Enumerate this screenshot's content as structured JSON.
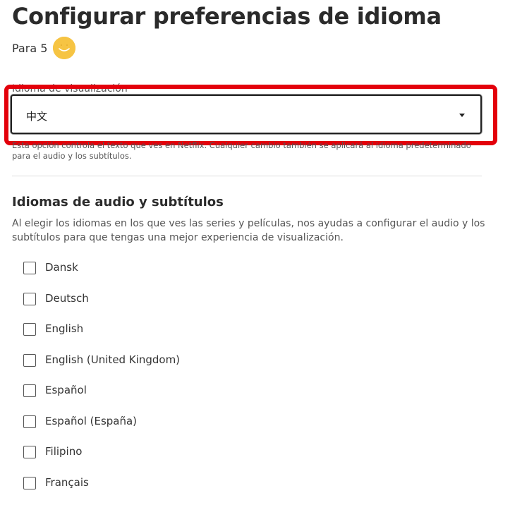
{
  "header": {
    "title": "Configurar preferencias de idioma",
    "profile_label": "Para 5",
    "avatar_icon": "smiley-face-icon",
    "avatar_color": "#f6c443"
  },
  "display_language": {
    "label": "Idioma de visualización",
    "selected": "中文",
    "help_text": "Esta opción controla el texto que ves en Netflix. Cualquier cambio también se aplicará al idioma predeterminado para el audio y los subtítulos.",
    "highlight_color": "#e3000b"
  },
  "audio_subtitles": {
    "title": "Idiomas de audio y subtítulos",
    "description": "Al elegir los idiomas en los que ves las series y películas, nos ayudas a configurar el audio y los subtítulos para que tengas una mejor experiencia de visualización.",
    "languages": [
      {
        "label": "Dansk",
        "checked": false
      },
      {
        "label": "Deutsch",
        "checked": false
      },
      {
        "label": "English",
        "checked": false
      },
      {
        "label": "English (United Kingdom)",
        "checked": false
      },
      {
        "label": "Español",
        "checked": false
      },
      {
        "label": "Español (España)",
        "checked": false
      },
      {
        "label": "Filipino",
        "checked": false
      },
      {
        "label": "Français",
        "checked": false
      }
    ]
  }
}
